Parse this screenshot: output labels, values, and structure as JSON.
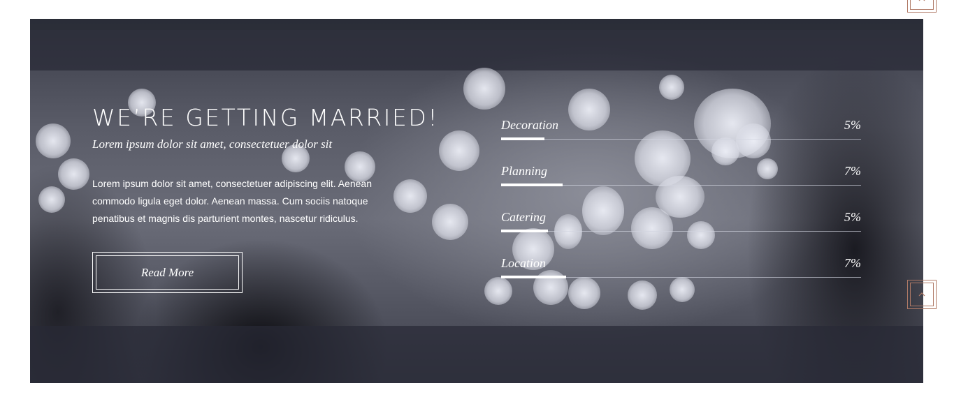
{
  "hero": {
    "title": "WE’RE GETTING MARRIED!",
    "subtitle": "Lorem ipsum dolor sit amet, consectetuer dolor sit",
    "paragraph": "Lorem ipsum dolor sit amet, consectetuer adipiscing elit. Aenean commodo ligula eget dolor. Aenean massa. Cum sociis natoque penatibus et magnis dis parturient montes, nascetur ridiculus.",
    "button_label": "Read More"
  },
  "skills": [
    {
      "label": "Decoration",
      "percent_text": "5%",
      "fill_fraction": 0.12
    },
    {
      "label": "Planning",
      "percent_text": "7%",
      "fill_fraction": 0.17
    },
    {
      "label": "Catering",
      "percent_text": "5%",
      "fill_fraction": 0.13
    },
    {
      "label": "Location",
      "percent_text": "7%",
      "fill_fraction": 0.18
    }
  ],
  "icons": {
    "top_button": "close-icon",
    "side_button": "chevron-up-icon"
  },
  "colors": {
    "accent": "#b07a66",
    "text": "#ffffff",
    "overlay": "#2a2c38"
  }
}
